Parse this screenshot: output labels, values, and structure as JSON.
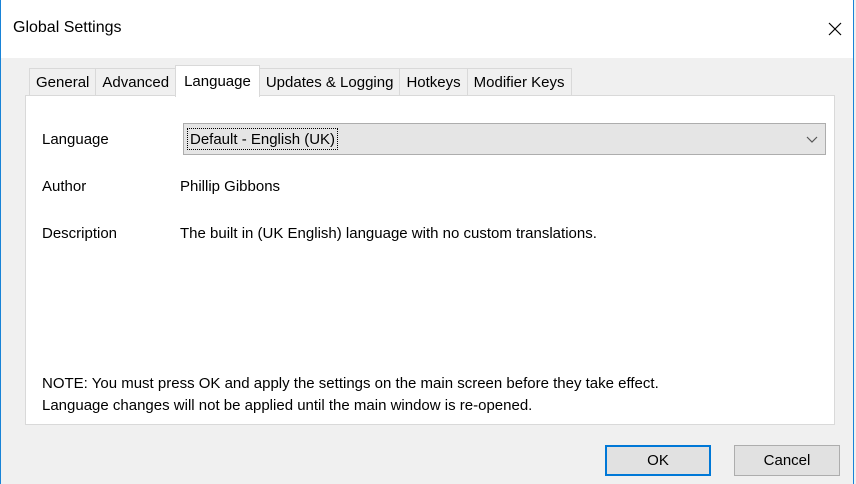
{
  "window": {
    "title": "Global Settings"
  },
  "tabs": [
    {
      "label": "General",
      "active": false
    },
    {
      "label": "Advanced",
      "active": false
    },
    {
      "label": "Language",
      "active": true
    },
    {
      "label": "Updates & Logging",
      "active": false
    },
    {
      "label": "Hotkeys",
      "active": false
    },
    {
      "label": "Modifier Keys",
      "active": false
    }
  ],
  "language_tab": {
    "language_label": "Language",
    "language_selected": "Default - English (UK)",
    "author_label": "Author",
    "author_value": "Phillip Gibbons",
    "description_label": "Description",
    "description_value": "The built in (UK English) language with no custom translations.",
    "note_line1": "NOTE: You must press OK and apply the settings on the main screen before they take effect.",
    "note_line2": "Language changes will not be applied until the main window is re-opened."
  },
  "buttons": {
    "ok": "OK",
    "cancel": "Cancel"
  },
  "icons": {
    "close": "close-icon",
    "dropdown": "chevron-down-icon"
  },
  "colors": {
    "accent": "#0078d7",
    "window_border": "#1883d7"
  }
}
